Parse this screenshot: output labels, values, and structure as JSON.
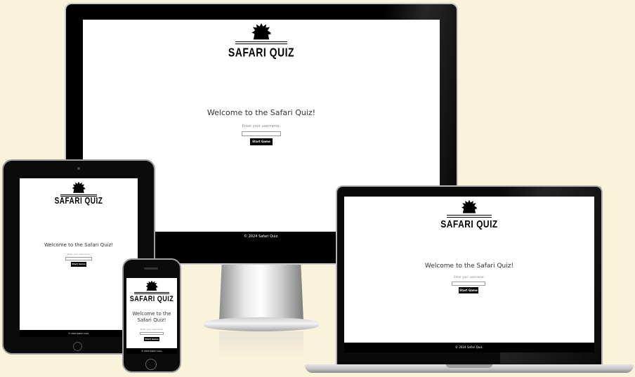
{
  "brand": {
    "logo_text": "SAFARI QUIZ",
    "mascot": "lion-head-icon"
  },
  "home": {
    "welcome": "Welcome to the Safari Quiz!",
    "username_prompt": "Enter your username:",
    "username_value": "",
    "start_button": "Start Game"
  },
  "footer": {
    "copyright": "© 2024 Safari Quiz."
  },
  "devices": [
    "desktop",
    "tablet",
    "phone",
    "laptop"
  ],
  "colors": {
    "background": "#faf3db",
    "screen": "#ffffff",
    "frame": "#0b0b0b",
    "button": "#000000"
  }
}
